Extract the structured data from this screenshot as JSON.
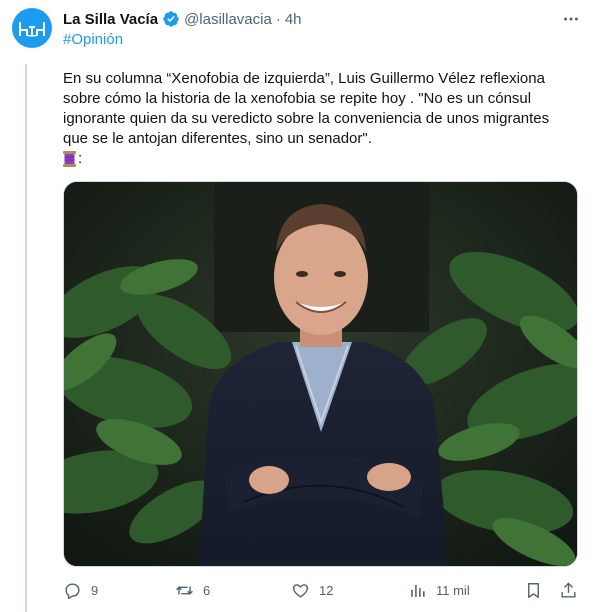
{
  "tweet": {
    "author_name": "La Silla Vacía",
    "handle": "@lasillavacia",
    "separator": "·",
    "time": "4h",
    "hashtag": "#Opinión",
    "body": "En su columna “Xenofobia de izquierda”, Luis Guillermo Vélez reflexiona sobre cómo la historia de la xenofobia se repite hoy . \"No es un cónsul ignorante quien da su veredicto sobre la conveniencia de unos migrantes que se le antojan diferentes, sino un senador\".",
    "emoji_suffix": ":",
    "icons": {
      "avatar": "chairs-logo",
      "verified": "verified-badge-icon",
      "more": "more-options-icon",
      "emoji": "spool-of-thread-emoji"
    },
    "colors": {
      "accent": "#1d9bf0",
      "text": "#0f1419",
      "secondary": "#536471",
      "border": "#cfd9de",
      "verified": "#1d9bf0"
    }
  },
  "actions": {
    "replies": "9",
    "reposts": "6",
    "likes": "12",
    "views": "11 mil"
  }
}
